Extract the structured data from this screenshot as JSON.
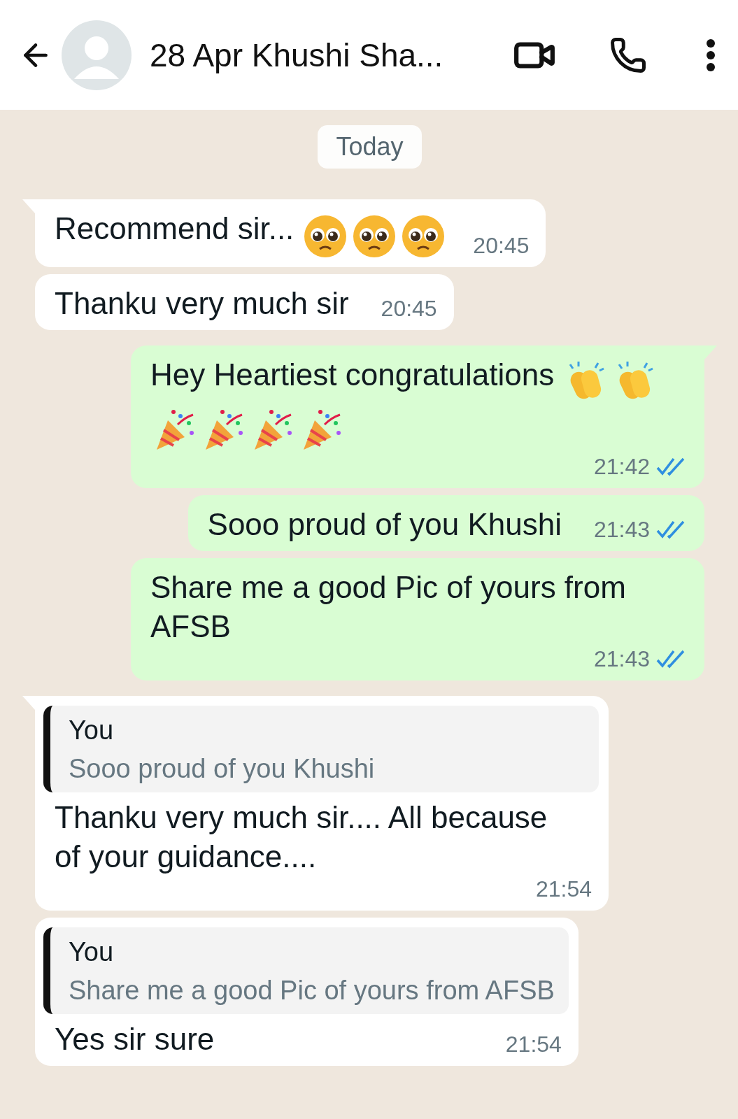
{
  "header": {
    "title": "28 Apr Khushi Sha..."
  },
  "date_chip": "Today",
  "messages": [
    {
      "kind": "incoming",
      "tail": true,
      "text": "Recommend sir...",
      "emojis": [
        {
          "kind": "pleading"
        },
        {
          "kind": "pleading"
        },
        {
          "kind": "pleading"
        }
      ],
      "time": "20:45"
    },
    {
      "kind": "incoming",
      "tail": false,
      "text": "Thanku very much sir",
      "time": "20:45"
    },
    {
      "kind": "outgoing",
      "tail": true,
      "text": "Hey Heartiest congratulations",
      "emojis": [
        {
          "kind": "clap"
        },
        {
          "kind": "clap"
        },
        {
          "kind": "party"
        },
        {
          "kind": "party"
        },
        {
          "kind": "party"
        },
        {
          "kind": "party"
        }
      ],
      "time": "21:42",
      "read": true
    },
    {
      "kind": "outgoing",
      "tail": false,
      "text": "Sooo proud of you Khushi",
      "time": "21:43",
      "read": true
    },
    {
      "kind": "outgoing",
      "tail": false,
      "text": "Share me a good Pic of yours from AFSB",
      "time": "21:43",
      "read": true
    },
    {
      "kind": "incoming",
      "tail": true,
      "quote": {
        "author": "You",
        "text": "Sooo proud of you Khushi"
      },
      "text": "Thanku very much sir.... All because of your guidance....",
      "time": "21:54"
    },
    {
      "kind": "incoming",
      "tail": false,
      "quote": {
        "author": "You",
        "text": "Share me a good Pic of yours from AFSB"
      },
      "text": "Yes sir sure",
      "time": "21:54"
    }
  ]
}
